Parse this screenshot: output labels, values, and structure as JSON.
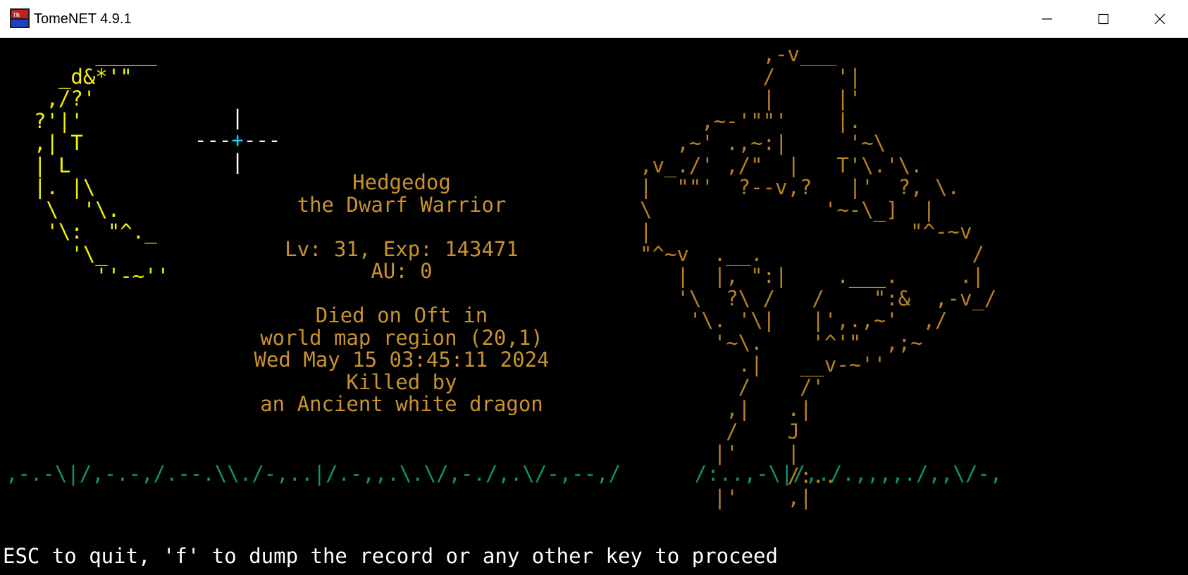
{
  "window": {
    "title": "TomeNET 4.9.1",
    "app_icon": "tomenet-app-icon",
    "controls": {
      "minimize_icon": "minimize-icon",
      "maximize_icon": "maximize-icon",
      "close_icon": "close-icon"
    }
  },
  "colors": {
    "background": "#000000",
    "moon": "#f4f000",
    "epitaph_text": "#c8922e",
    "tombstone": "#b98120",
    "grass": "#0e9a5a",
    "prompt": "#ffffff",
    "cursor": "#ffffff",
    "cursor_center": "#00d8ff"
  },
  "art": {
    "moon": "     _____\n  _d&*'\"\n ,/?'\n?'|'\n,| T\n| L\n|. |\\\n \\  '\\.\n '\\:  \"^._\n   '\\_\n     ''-~''",
    "tombstone": "          ,-v___\n          /     '|\n          |     |'\n     ,~-'\"\"'    |.\n   ,~' .,~:|     '~\\\n,v_./' ,/\"  |   T'\\.'\\.\n|  \"\"'  ?--v,?   |'  ?, \\.\n\\              '~-\\_]  |\n|                     \"^-~v\n\"^~v  .__.                 /\n   |  |, \":|    .___.     .|\n   '\\  ?\\ /   /    \":&  ,-v_/\n    '\\. '\\|   |',.,~'  ,/\n      '~\\.    '^'\"  ,;~\n        .|   __v-~''\n        /    /'\n       ,|   .|\n       /    J\n      |'    |\n            /:..\n      |'    ,|",
    "grass": ",-.-\\|/,-.-,/.--.\\\\./-,..|/.-,,.\\.\\/,-./,.\\/-,--,/      /:..,-\\|/,./.,,,,./,,\\/-,",
    "cursor": "   |\n---+---\n   |"
  },
  "epitaph": {
    "name": "Hedgedog",
    "title": "the Dwarf Warrior",
    "level_exp": "Lv: 31, Exp: 143471",
    "gold": "AU: 0",
    "died_on": "Died on Oft in",
    "location": "world map region (20,1)",
    "date": "Wed May 15 03:45:11 2024",
    "killed_by": "Killed by",
    "killer": "an Ancient white dragon"
  },
  "prompt": "ESC to quit, 'f' to dump the record or any other key to proceed"
}
